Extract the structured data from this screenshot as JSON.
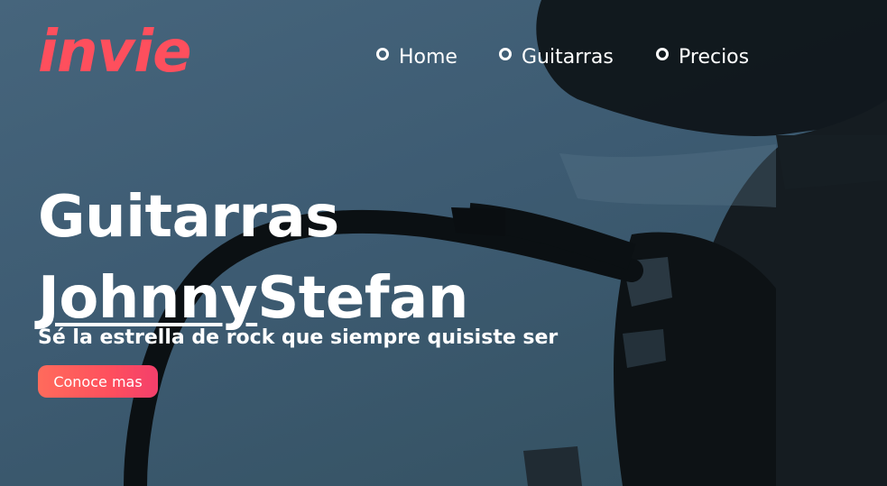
{
  "brand": {
    "logo_text": "invie",
    "logo_color": "#fe4f5d"
  },
  "nav": {
    "items": [
      {
        "label": "Home"
      },
      {
        "label": "Guitarras"
      },
      {
        "label": "Precios"
      }
    ]
  },
  "hero": {
    "title_line1": "Guitarras",
    "title_line2_underlined": "Johnny",
    "title_line2_rest": "Stefan",
    "subtitle": "Sé la estrella de rock que siempre quisiste ser",
    "cta_label": "Conoce mas"
  },
  "colors": {
    "accent": "#fe4f5d",
    "background": "#3f5d74",
    "text": "#ffffff"
  }
}
